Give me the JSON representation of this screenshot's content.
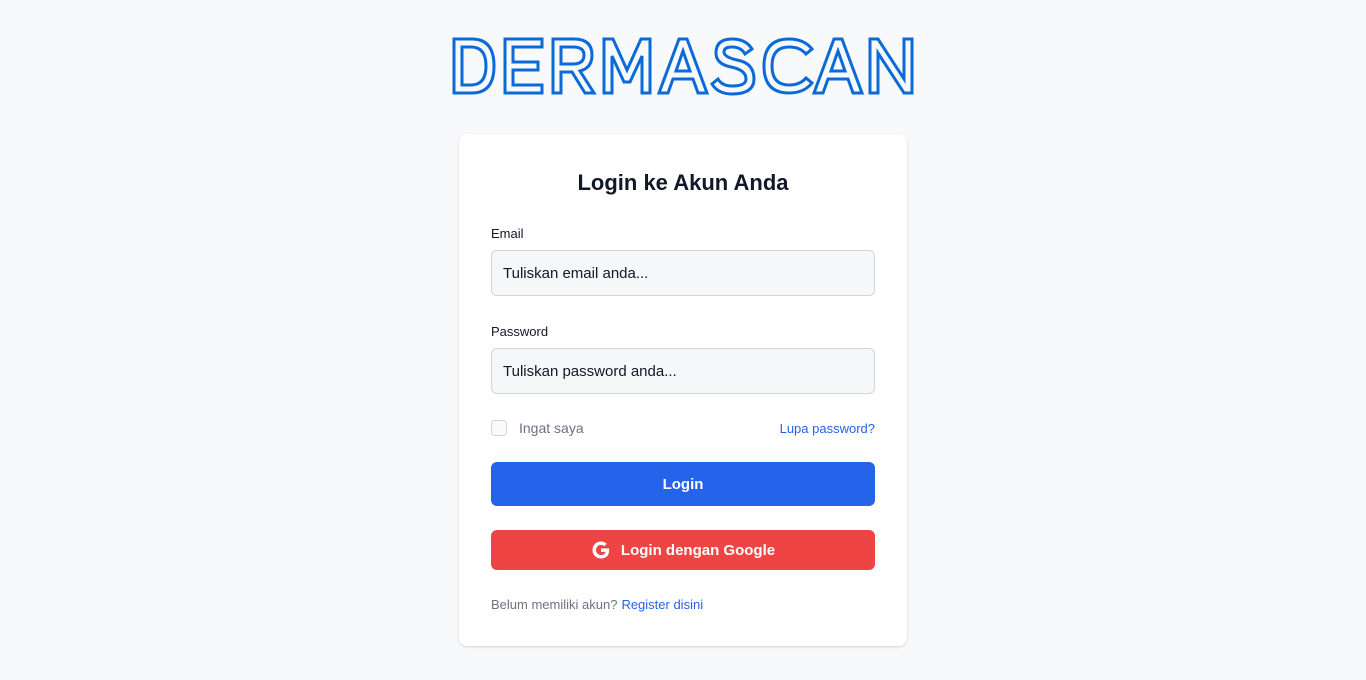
{
  "brand": {
    "name": "DERMASCAN",
    "color": "#0a6bd8"
  },
  "login_form": {
    "title": "Login ke Akun Anda",
    "email": {
      "label": "Email",
      "placeholder": "Tuliskan email anda...",
      "value": ""
    },
    "password": {
      "label": "Password",
      "placeholder": "Tuliskan password anda...",
      "value": ""
    },
    "remember_me": {
      "label": "Ingat saya",
      "checked": false
    },
    "forgot_password_label": "Lupa password?",
    "login_button_label": "Login",
    "google_button": {
      "label": "Login dengan Google",
      "icon": "google-icon"
    },
    "register": {
      "prompt": "Belum memiliki akun?",
      "link_label": "Register disini"
    }
  },
  "colors": {
    "primary": "#2563eb",
    "google_red": "#ef4444",
    "background": "#f8f9fb",
    "card": "#ffffff"
  }
}
